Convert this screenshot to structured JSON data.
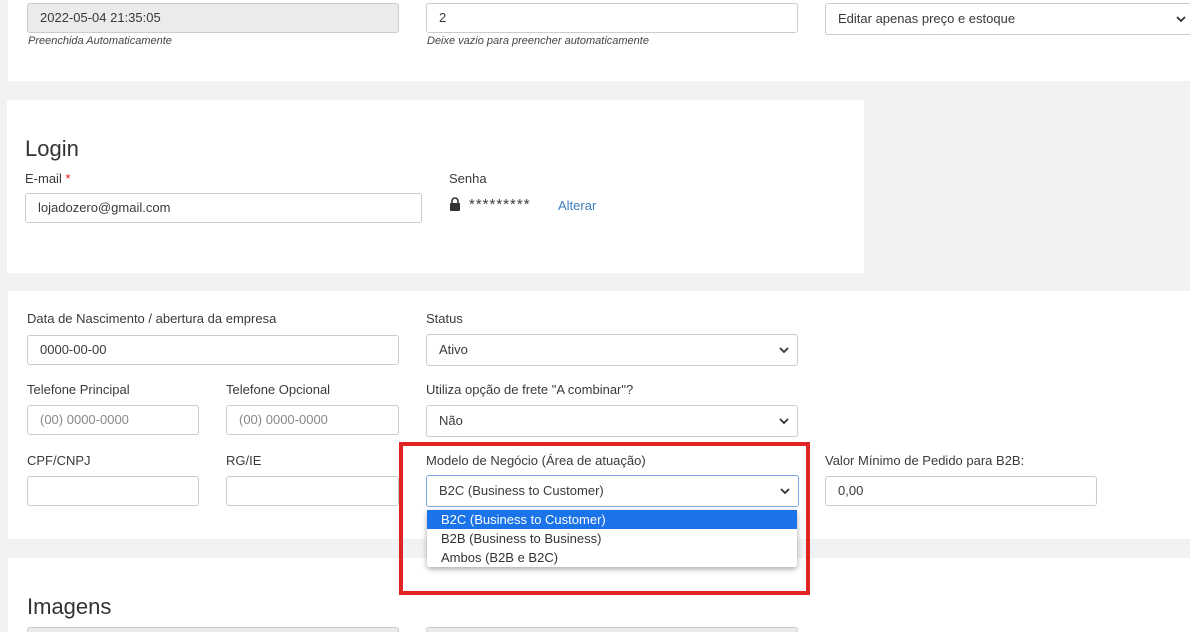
{
  "top": {
    "date_value": "2022-05-04 21:35:05",
    "date_help": "Preenchida Automaticamente",
    "number_value": "2",
    "number_help": "Deixe vazio para preencher automaticamente",
    "edit_select": "Editar apenas preço e estoque"
  },
  "login": {
    "title": "Login",
    "email_label": "E-mail",
    "email_required": "*",
    "email_value": "lojadozero@gmail.com",
    "password_label": "Senha",
    "password_mask": "*********",
    "change_link": "Alterar"
  },
  "details": {
    "birth_label": "Data de Nascimento / abertura da empresa",
    "birth_value": "0000-00-00",
    "status_label": "Status",
    "status_value": "Ativo",
    "phone_label": "Telefone Principal",
    "phone_placeholder": "(00) 0000-0000",
    "phone_opt_label": "Telefone Opcional",
    "phone_opt_placeholder": "(00) 0000-0000",
    "freight_label": "Utiliza opção de frete \"A combinar\"?",
    "freight_value": "Não",
    "cpf_label": "CPF/CNPJ",
    "rg_label": "RG/IE",
    "model_label": "Modelo de Negócio (Área de atuação)",
    "model_value": "B2C (Business to Customer)",
    "model_options": [
      "B2C (Business to Customer)",
      "B2B (Business to Business)",
      "Ambos (B2B e B2C)"
    ],
    "min_order_label": "Valor Mínimo de Pedido para B2B:",
    "min_order_value": "0,00"
  },
  "images": {
    "title": "Imagens"
  },
  "colors": {
    "highlight": "#e02424",
    "option_selected": "#1a73e8",
    "link": "#3a7bbf"
  }
}
